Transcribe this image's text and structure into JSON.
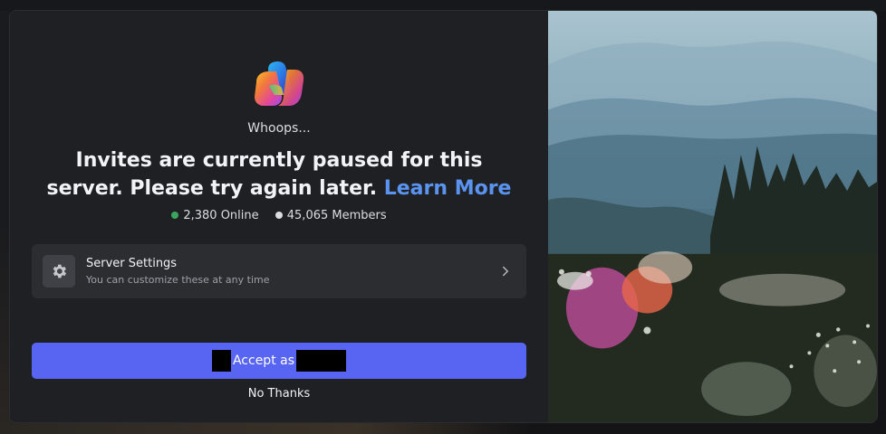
{
  "invite": {
    "eyebrow": "Whoops...",
    "headline": "Invites are currently paused for this server. Please try again later.",
    "learn_more": "Learn More",
    "online_count": "2,380 Online",
    "member_count": "45,065 Members"
  },
  "server_settings": {
    "title": "Server Settings",
    "subtitle": "You can customize these at any time",
    "icon": "gear-icon"
  },
  "actions": {
    "accept_label": "Accept as",
    "no_thanks_label": "No Thanks"
  },
  "colors": {
    "online": "#3ba55d",
    "members": "#dbdee1",
    "accent": "#5865f2",
    "link": "#5a94f0"
  }
}
